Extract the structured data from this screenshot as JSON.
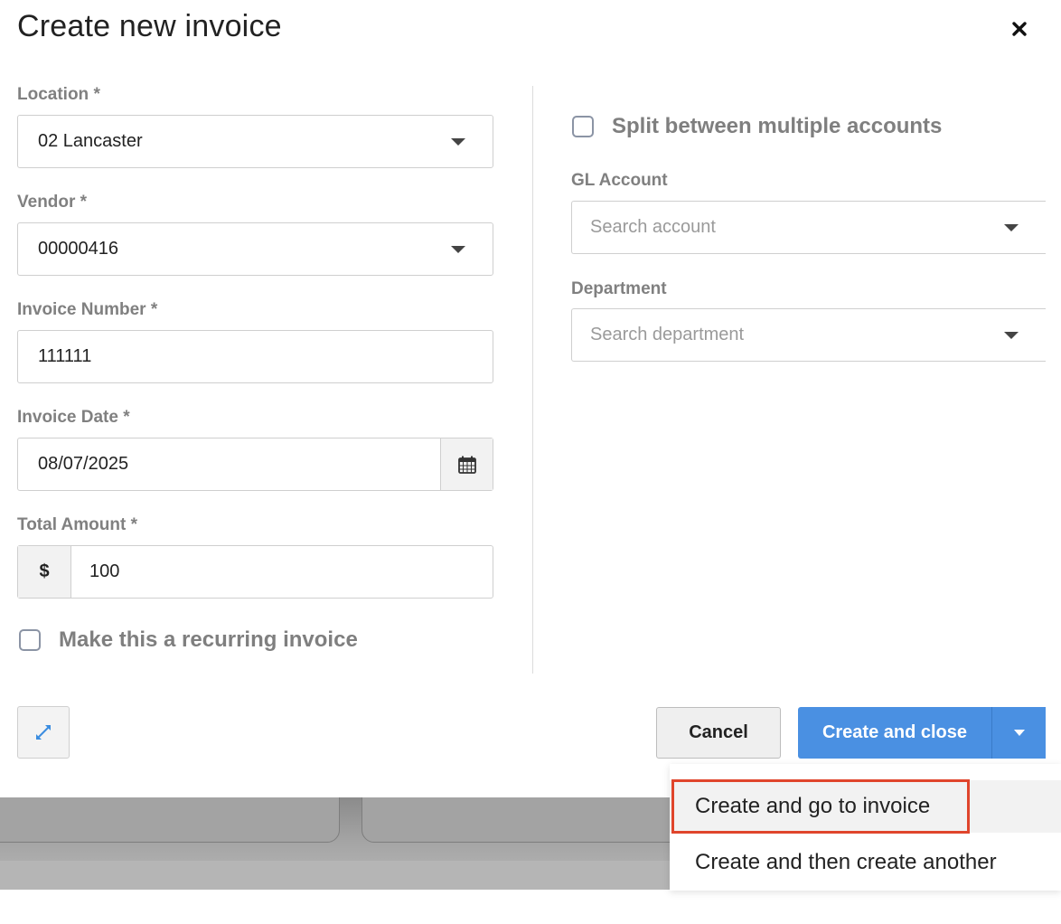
{
  "modal": {
    "title": "Create new invoice",
    "close_icon": "close-icon"
  },
  "left": {
    "location": {
      "label": "Location *",
      "value": "02 Lancaster"
    },
    "vendor": {
      "label": "Vendor *",
      "value": "00000416"
    },
    "invoice_number": {
      "label": "Invoice Number *",
      "value": "111111"
    },
    "invoice_date": {
      "label": "Invoice Date *",
      "value": "08/07/2025"
    },
    "total_amount": {
      "label": "Total Amount *",
      "currency": "$",
      "value": "100"
    },
    "recurring": {
      "label": "Make this a recurring invoice",
      "checked": false
    }
  },
  "right": {
    "split": {
      "label": "Split between multiple accounts",
      "checked": false
    },
    "gl_account": {
      "label": "GL Account",
      "placeholder": "Search account"
    },
    "department": {
      "label": "Department",
      "placeholder": "Search department"
    }
  },
  "footer": {
    "cancel_label": "Cancel",
    "primary_label": "Create and close",
    "menu_items": [
      "Create and go to invoice",
      "Create and then create another"
    ]
  },
  "colors": {
    "primary": "#4a90e2",
    "highlight": "#e0452c"
  }
}
